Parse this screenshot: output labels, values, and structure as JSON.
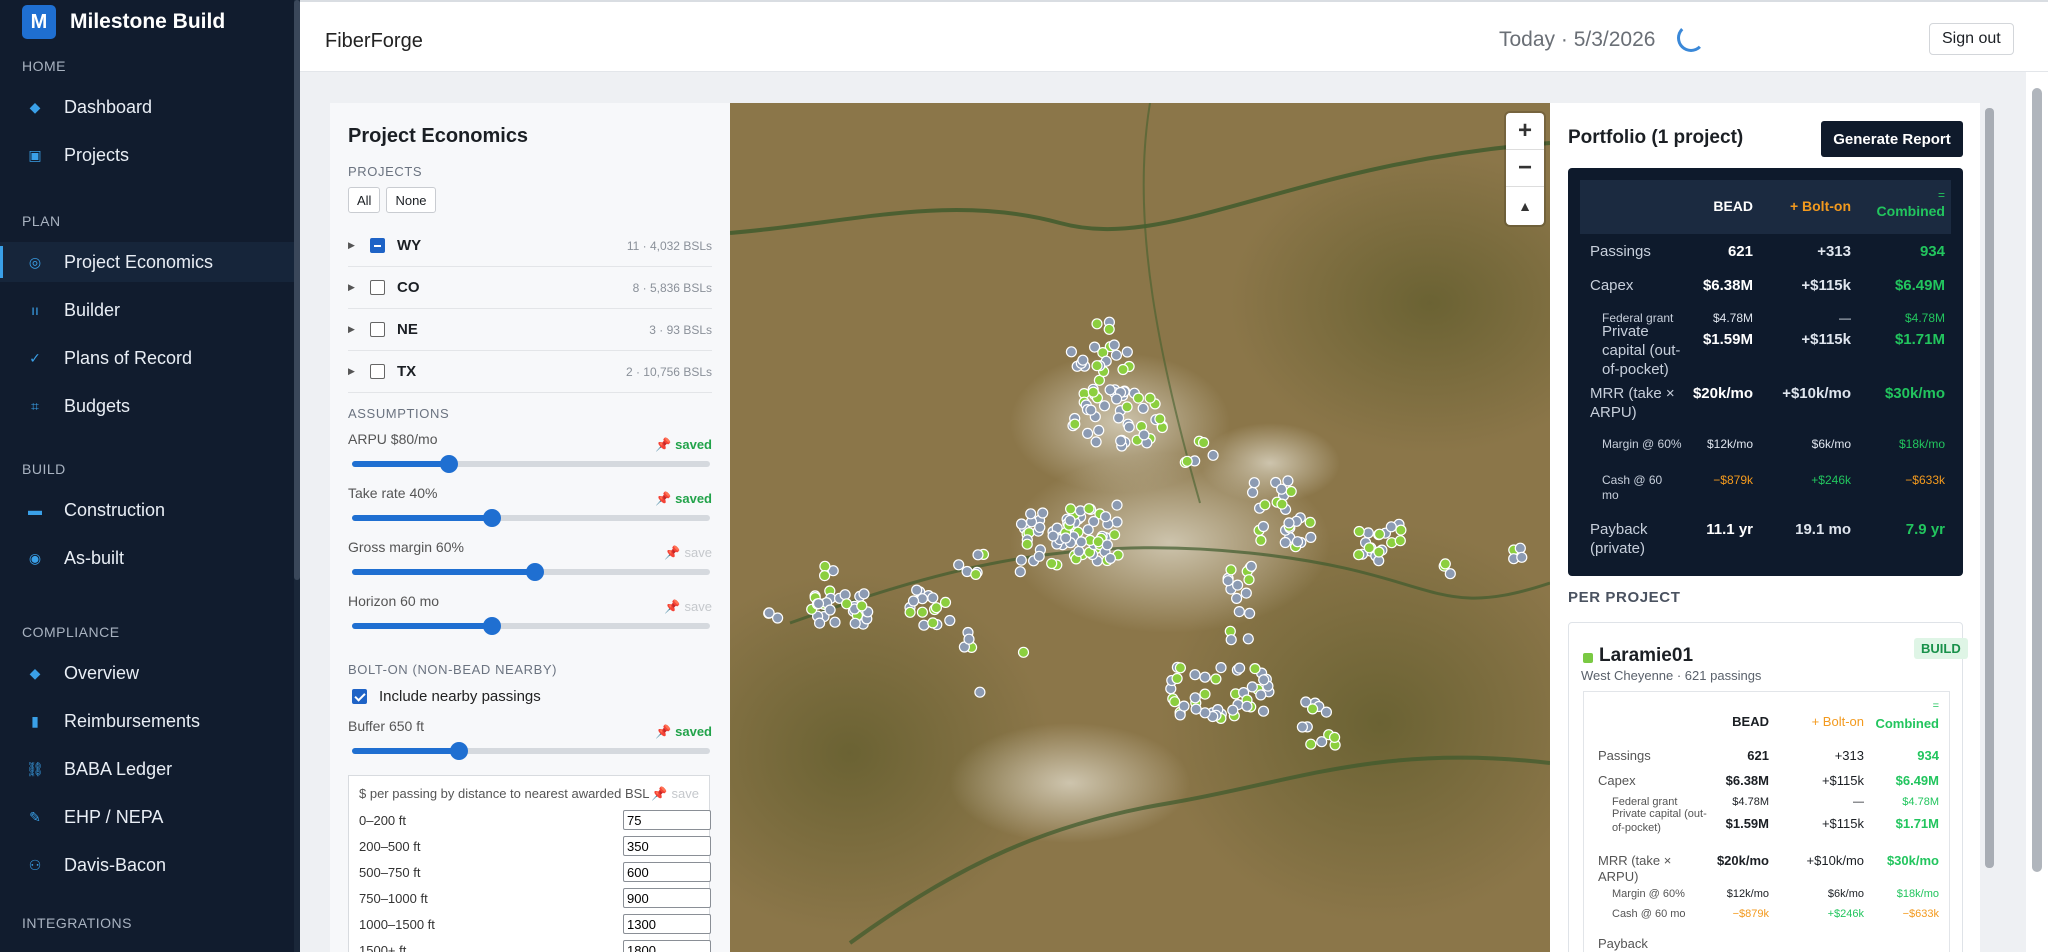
{
  "app": {
    "name": "Milestone Build",
    "logo": "M"
  },
  "nav": [
    {
      "section": "HOME",
      "items": [
        {
          "label": "Dashboard",
          "icon": "diamond-icon"
        },
        {
          "label": "Projects",
          "icon": "square-icon"
        }
      ]
    },
    {
      "section": "PLAN",
      "items": [
        {
          "label": "Project Economics",
          "icon": "target-icon",
          "active": true
        },
        {
          "label": "Builder",
          "icon": "builder-icon"
        },
        {
          "label": "Plans of Record",
          "icon": "check-icon"
        },
        {
          "label": "Budgets",
          "icon": "hash-icon"
        }
      ]
    },
    {
      "section": "BUILD",
      "items": [
        {
          "label": "Construction",
          "icon": "truck-icon"
        },
        {
          "label": "As-built",
          "icon": "dot-icon"
        }
      ]
    },
    {
      "section": "COMPLIANCE",
      "items": [
        {
          "label": "Overview",
          "icon": "diamond-icon"
        },
        {
          "label": "Reimbursements",
          "icon": "document-icon"
        },
        {
          "label": "BABA Ledger",
          "icon": "chain-icon"
        },
        {
          "label": "EHP / NEPA",
          "icon": "leaf-icon"
        },
        {
          "label": "Davis-Bacon",
          "icon": "workers-icon"
        }
      ]
    },
    {
      "section": "INTEGRATIONS",
      "items": []
    }
  ],
  "topbar": {
    "title": "FiberForge",
    "today": "Today · 5/3/2026",
    "signout": "Sign out"
  },
  "econ": {
    "title": "Project Economics",
    "projects_label": "PROJECTS",
    "all": "All",
    "none": "None",
    "projects": [
      {
        "code": "WY",
        "count": "11 · 4,032 BSLs",
        "state": "indeterminate"
      },
      {
        "code": "CO",
        "count": "8 · 5,836 BSLs",
        "state": "unchecked"
      },
      {
        "code": "NE",
        "count": "3 · 93 BSLs",
        "state": "unchecked"
      },
      {
        "code": "TX",
        "count": "2 · 10,756 BSLs",
        "state": "unchecked"
      }
    ],
    "assumptions_label": "ASSUMPTIONS",
    "sliders": [
      {
        "label": "ARPU $80/mo",
        "status": "saved",
        "saved": true,
        "level": 0.27
      },
      {
        "label": "Take rate 40%",
        "status": "saved",
        "saved": true,
        "level": 0.39
      },
      {
        "label": "Gross margin 60%",
        "status": "save",
        "saved": false,
        "level": 0.51
      },
      {
        "label": "Horizon 60 mo",
        "status": "save",
        "saved": false,
        "level": 0.39
      }
    ],
    "bolt_label": "BOLT-ON (NON-BEAD NEARBY)",
    "include_label": "Include nearby passings",
    "buffer": {
      "label": "Buffer 650 ft",
      "status": "saved",
      "saved": true,
      "level": 0.3
    },
    "dist_title": "$ per passing by distance to nearest awarded BSL",
    "dist_status": "save",
    "dist": [
      {
        "label": "0–200 ft",
        "value": "75"
      },
      {
        "label": "200–500 ft",
        "value": "350"
      },
      {
        "label": "500–750 ft",
        "value": "600"
      },
      {
        "label": "750–1000 ft",
        "value": "900"
      },
      {
        "label": "1000–1500 ft",
        "value": "1300"
      },
      {
        "label": "1500+ ft",
        "value": "1800"
      }
    ]
  },
  "map": {
    "zoom_in": "+",
    "zoom_out": "−",
    "compass": "▲"
  },
  "portfolio": {
    "title": "Portfolio (1 project)",
    "generate": "Generate Report",
    "headers": {
      "bead": "BEAD",
      "bolt": "+ Bolt-on",
      "comb_eq": "=",
      "comb": "Combined"
    },
    "rows": [
      {
        "label": "Passings",
        "bead": "621",
        "bolt": "+313",
        "comb": "934",
        "major": true
      },
      {
        "label": "Capex",
        "bead": "$6.38M",
        "bolt": "+$115k",
        "comb": "$6.49M",
        "major": true
      },
      {
        "label": "Federal grant",
        "bead": "$4.78M",
        "bolt": "—",
        "comb": "$4.78M",
        "major": false
      },
      {
        "label": "Private capital (out-of-pocket)",
        "bead": "$1.59M",
        "bolt": "+$115k",
        "comb": "$1.71M",
        "major": true,
        "indent": true
      },
      {
        "label": "MRR (take × ARPU)",
        "bead": "$20k/mo",
        "bolt": "+$10k/mo",
        "comb": "$30k/mo",
        "major": true
      },
      {
        "label": "Margin @ 60%",
        "bead": "$12k/mo",
        "bolt": "$6k/mo",
        "comb": "$18k/mo",
        "major": false
      },
      {
        "label": "Cash @ 60 mo",
        "bead": "−$879k",
        "bolt": "+$246k",
        "comb": "−$633k",
        "major": false,
        "signed": true
      },
      {
        "label": "Payback (private)",
        "bead": "11.1 yr",
        "bolt": "19.1 mo",
        "comb": "7.9 yr",
        "major": true
      }
    ],
    "per_project_label": "PER PROJECT",
    "project": {
      "name": "Laramie01",
      "sub": "West Cheyenne · 621 passings",
      "badge": "BUILD",
      "rows": [
        {
          "label": "Passings",
          "bead": "621",
          "bolt": "+313",
          "comb": "934"
        },
        {
          "label": "Capex",
          "bead": "$6.38M",
          "bolt": "+$115k",
          "comb": "$6.49M"
        },
        {
          "label": "Federal grant",
          "bead": "$4.78M",
          "bolt": "—",
          "comb": "$4.78M"
        },
        {
          "label": "Private capital (out-of-pocket)",
          "bead": "$1.59M",
          "bolt": "+$115k",
          "comb": "$1.71M"
        },
        {
          "label": "MRR (take × ARPU)",
          "bead": "$20k/mo",
          "bolt": "+$10k/mo",
          "comb": "$30k/mo"
        },
        {
          "label": "Margin @ 60%",
          "bead": "$12k/mo",
          "bolt": "$6k/mo",
          "comb": "$18k/mo"
        },
        {
          "label": "Cash @ 60 mo",
          "bead": "−$879k",
          "bolt": "+$246k",
          "comb": "−$633k"
        },
        {
          "label": "Payback",
          "bead": "",
          "bolt": "",
          "comb": ""
        }
      ]
    }
  },
  "colors": {
    "sidebar": "#111c2e",
    "accent": "#1f6fd1",
    "bolt": "#f39a1e",
    "combined": "#22c55e",
    "saved": "#22a34a"
  }
}
